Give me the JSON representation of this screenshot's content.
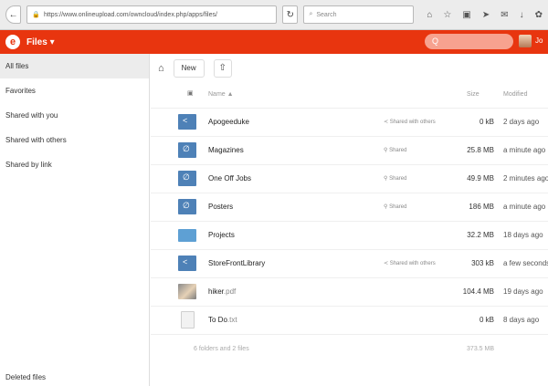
{
  "browser": {
    "url": "https://www.onlineupload.com/owncloud/index.php/apps/files/",
    "search_placeholder": "Search",
    "back_icon": "back-arrow-icon"
  },
  "app": {
    "title": "Files ▾",
    "search_placeholder": "Q",
    "user_partial": "Jo"
  },
  "sidebar": {
    "items": [
      {
        "label": "All files"
      },
      {
        "label": "Favorites"
      },
      {
        "label": "Shared with you"
      },
      {
        "label": "Shared with others"
      },
      {
        "label": "Shared by link"
      }
    ],
    "deleted_label": "Deleted files"
  },
  "toolbar": {
    "new_label": "New"
  },
  "table": {
    "name_header": "Name ▲",
    "size_header": "Size",
    "modified_header": "Modified"
  },
  "files": [
    {
      "name": "Apogeeduke",
      "ext": "",
      "type": "shared-folder",
      "share": "Shared with others",
      "size": "0 kB",
      "modified": "2 days ago"
    },
    {
      "name": "Magazines",
      "ext": "",
      "type": "link-folder",
      "share": "Shared",
      "size": "25.8 MB",
      "modified": "a minute ago"
    },
    {
      "name": "One Off Jobs",
      "ext": "",
      "type": "link-folder",
      "share": "Shared",
      "size": "49.9 MB",
      "modified": "2 minutes ago"
    },
    {
      "name": "Posters",
      "ext": "",
      "type": "link-folder",
      "share": "Shared",
      "size": "186 MB",
      "modified": "a minute ago"
    },
    {
      "name": "Projects",
      "ext": "",
      "type": "folder",
      "share": "",
      "size": "32.2 MB",
      "modified": "18 days ago"
    },
    {
      "name": "StoreFrontLibrary",
      "ext": "",
      "type": "shared-folder",
      "share": "Shared with others",
      "size": "303 kB",
      "modified": "a few seconds ago"
    },
    {
      "name": "hiker",
      "ext": ".pdf",
      "type": "image",
      "share": "",
      "size": "104.4 MB",
      "modified": "19 days ago"
    },
    {
      "name": "To Do",
      "ext": ".txt",
      "type": "doc",
      "share": "",
      "size": "0 kB",
      "modified": "8 days ago"
    }
  ],
  "footer": {
    "summary": "6 folders and 2 files",
    "total": "373.5 MB"
  }
}
